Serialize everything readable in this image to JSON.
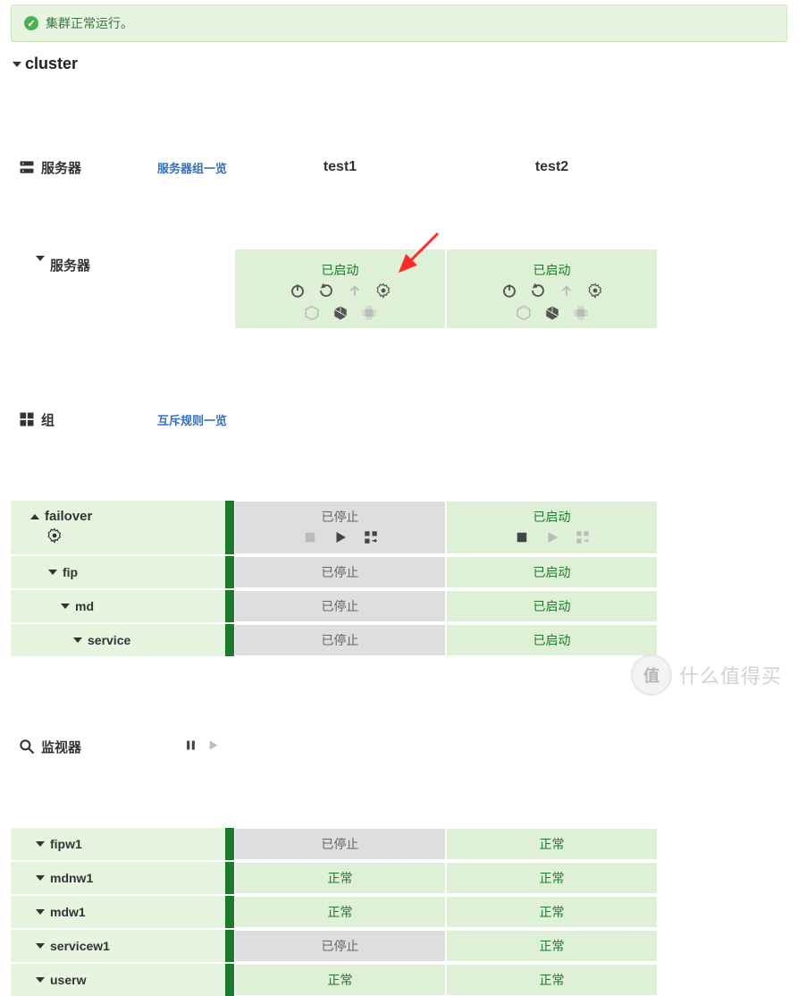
{
  "alert": {
    "message": "集群正常运行。"
  },
  "cluster": {
    "title": "cluster"
  },
  "columns": {
    "c1": "test1",
    "c2": "test2"
  },
  "servers_section": {
    "title": "服务器",
    "list_link": "服务器组一览"
  },
  "server_tree": {
    "label": "服务器",
    "c1": {
      "status": "已启动"
    },
    "c2": {
      "status": "已启动"
    }
  },
  "groups_section": {
    "title": "组",
    "list_link": "互斥规则一览"
  },
  "group": {
    "name": "failover",
    "c1_status": "已停止",
    "c2_status": "已启动",
    "items": [
      {
        "name": "fip",
        "c1": "已停止",
        "c2": "已启动"
      },
      {
        "name": "md",
        "c1": "已停止",
        "c2": "已启动"
      },
      {
        "name": "service",
        "c1": "已停止",
        "c2": "已启动"
      }
    ]
  },
  "monitors_section": {
    "title": "监视器"
  },
  "monitors": [
    {
      "name": "fipw1",
      "c1": "已停止",
      "c2": "正常"
    },
    {
      "name": "mdnw1",
      "c1": "正常",
      "c2": "正常"
    },
    {
      "name": "mdw1",
      "c1": "正常",
      "c2": "正常"
    },
    {
      "name": "servicew1",
      "c1": "已停止",
      "c2": "正常"
    },
    {
      "name": "userw",
      "c1": "正常",
      "c2": "正常"
    }
  ],
  "watermark": {
    "text": "什么值得买",
    "badge": "值"
  }
}
